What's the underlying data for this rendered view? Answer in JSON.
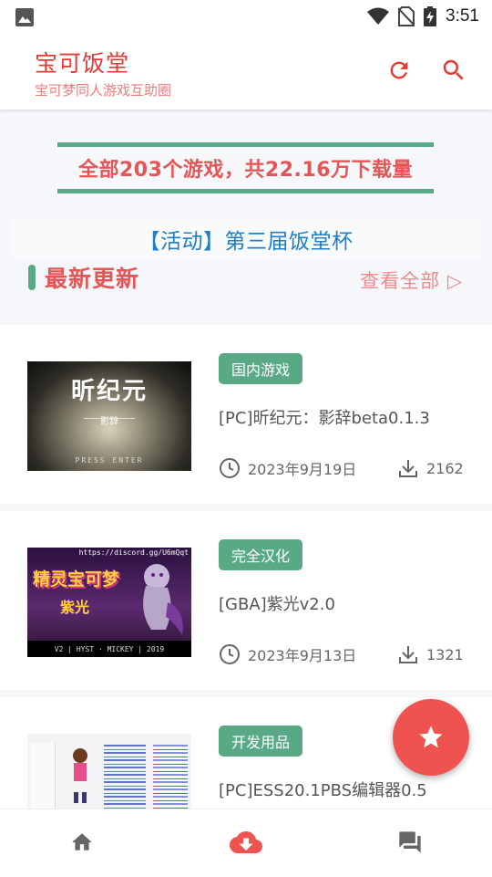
{
  "status_bar": {
    "time": "3:51"
  },
  "app_bar": {
    "title": "宝可饭堂",
    "subtitle": "宝可梦同人游戏互助圈",
    "accent_color": "#e53935"
  },
  "stats_banner": {
    "text": "全部203个游戏，共22.16万下载量"
  },
  "event_banner": {
    "text": "【活动】第三届饭堂杯"
  },
  "section": {
    "title": "最新更新",
    "view_all": "查看全部 ▷"
  },
  "games": [
    {
      "tag": "国内游戏",
      "title": "[PC]昕纪元：影辞beta0.1.3",
      "date": "2023年9月19日",
      "downloads": "2162",
      "thumb": {
        "main": "昕纪元",
        "sub": "影辞",
        "press": "PRESS ENTER"
      }
    },
    {
      "tag": "完全汉化",
      "title": "[GBA]紫光v2.0",
      "date": "2023年9月13日",
      "downloads": "1321",
      "thumb": {
        "url": "https://discord.gg/U6mQqt",
        "logo": "精灵宝可梦",
        "sub": "紫光",
        "credits": "V2 | HYST · MICKEY | 2019"
      }
    },
    {
      "tag": "开发用品",
      "title": "[PC]ESS20.1PBS编辑器0.5"
    }
  ],
  "icons": {
    "refresh": "refresh-icon",
    "search": "search-icon",
    "clock": "clock-icon",
    "download": "download-icon",
    "fab": "star-icon",
    "nav_home": "home-icon",
    "nav_download": "cloud-download-icon",
    "nav_chat": "chat-icon"
  },
  "colors": {
    "accent": "#e53935",
    "green": "#5aa986",
    "blue": "#1e7ec8",
    "fab": "#ef5350"
  }
}
